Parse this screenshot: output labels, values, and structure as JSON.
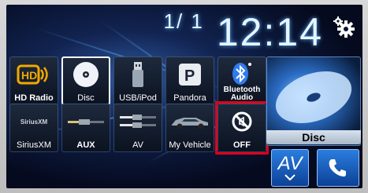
{
  "clock": {
    "date": "1/ 1",
    "time": "12:14"
  },
  "sources_row1": [
    {
      "label": "HD Radio",
      "icon": "hd-radio-icon"
    },
    {
      "label": "Disc",
      "icon": "disc-icon"
    },
    {
      "label": "USB/iPod",
      "icon": "usb-icon"
    },
    {
      "label": "Pandora",
      "icon": "pandora-icon"
    },
    {
      "label": "Bluetooth Audio",
      "icon": "bluetooth-icon"
    }
  ],
  "sources_row2": [
    {
      "label": "SiriusXM",
      "badge": "SiriusXM",
      "icon": "siriusxm-icon"
    },
    {
      "label": "AUX",
      "icon": "aux-cable-icon"
    },
    {
      "label": "AV",
      "icon": "av-cable-icon"
    },
    {
      "label": "My Vehicle",
      "icon": "car-icon"
    },
    {
      "label": "OFF",
      "icon": "off-icon"
    }
  ],
  "current_source": {
    "label": "Disc"
  },
  "av_button": {
    "label": "AV"
  },
  "colors": {
    "highlight": "#e0001a",
    "accent": "#2b7fe0"
  }
}
